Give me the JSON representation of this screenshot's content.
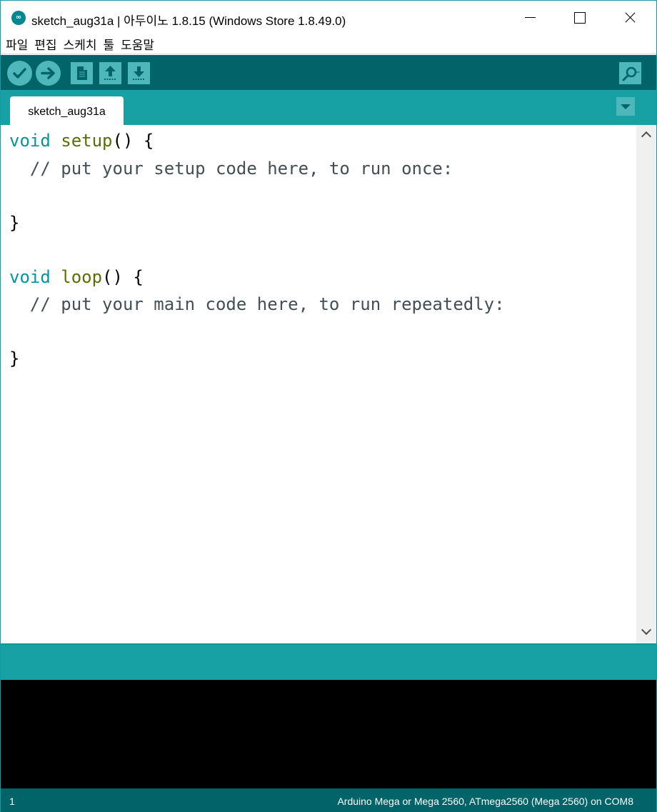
{
  "window": {
    "title": "sketch_aug31a | 아두이노 1.8.15 (Windows Store 1.8.49.0)",
    "app_icon": "arduino-logo-icon"
  },
  "menu": [
    "파일",
    "편집",
    "스케치",
    "툴",
    "도움말"
  ],
  "toolbar": {
    "buttons": [
      "verify-icon",
      "upload-icon",
      "new-icon",
      "open-icon",
      "save-icon",
      "serial-monitor-icon"
    ],
    "accent": "#006468",
    "button_color": "#4db7bb"
  },
  "tabs": [
    {
      "label": "sketch_aug31a",
      "active": true
    }
  ],
  "code": {
    "l1_kw": "void",
    "l1_fn": "setup",
    "l1_rest": "() {",
    "l2": "  // put your setup code here, to run once:",
    "l4": "}",
    "l6_kw": "void",
    "l6_fn": "loop",
    "l6_rest": "() {",
    "l7": "  // put your main code here, to run repeatedly:",
    "l9": "}"
  },
  "status": {
    "line_number": "1",
    "board": "Arduino Mega or Mega 2560, ATmega2560 (Mega 2560) on COM8"
  },
  "colors": {
    "keyword": "#00979c",
    "function": "#5e6d03",
    "comment": "#434f54",
    "tab_bar": "#17a1a5"
  }
}
